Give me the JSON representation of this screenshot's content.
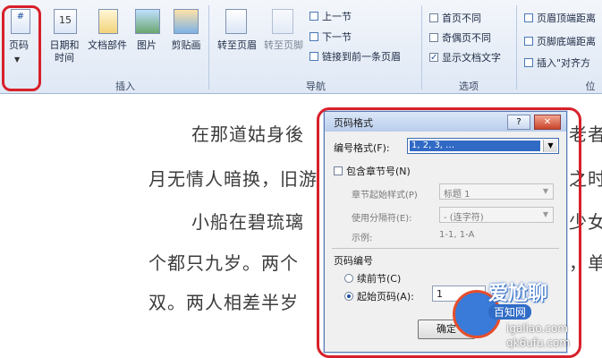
{
  "ribbon": {
    "page_number": "页码",
    "date_time": "日期和\n时间",
    "doc_parts": "文档部件",
    "picture": "图片",
    "clipart": "剪贴画",
    "group_insert": "插入",
    "goto_header": "转至页眉",
    "goto_footer": "转至页脚",
    "prev_section": "上一节",
    "next_section": "下一节",
    "link_prev": "链接到前一条页眉",
    "group_nav": "导航",
    "first_page_diff": "首页不同",
    "odd_even_diff": "奇偶页不同",
    "show_doc_text": "显示文档文字",
    "group_options": "选项",
    "header_top": "页眉顶端距离",
    "footer_bottom": "页脚底端距离",
    "insert_align": "插入\"对齐方",
    "group_position": "位"
  },
  "document": {
    "lines": [
      "在那道姑身後",
      "月无情人暗换，旧游",
      "小船在碧琉璃",
      "个都只九岁。两个",
      "双。两人相差半岁"
    ],
    "right_fragments": [
      "老者",
      "之时",
      "少女",
      "，单",
      ""
    ]
  },
  "dialog": {
    "title": "页码格式",
    "help": "?",
    "close": "✕",
    "number_format_label": "编号格式(F):",
    "number_format_value": "1, 2, 3, …",
    "include_chapter": "包含章节号(N)",
    "chapter_style_label": "章节起始样式(P)",
    "chapter_style_value": "标题 1",
    "separator_label": "使用分隔符(E):",
    "separator_value": "-    (连字符)",
    "example_label": "示例:",
    "example_value": "1-1, 1-A",
    "page_numbering": "页码编号",
    "continue_prev": "续前节(C)",
    "start_at": "起始页码(A):",
    "start_value": "1",
    "ok_button": "确定"
  },
  "watermark": {
    "site": "爱尬聊",
    "url": "igaliao.com",
    "badge": "百知网",
    "url2": "qk6ufu.com"
  },
  "colors": {
    "highlight_red": "#d8202a",
    "accent_blue": "#1d4ea0"
  }
}
